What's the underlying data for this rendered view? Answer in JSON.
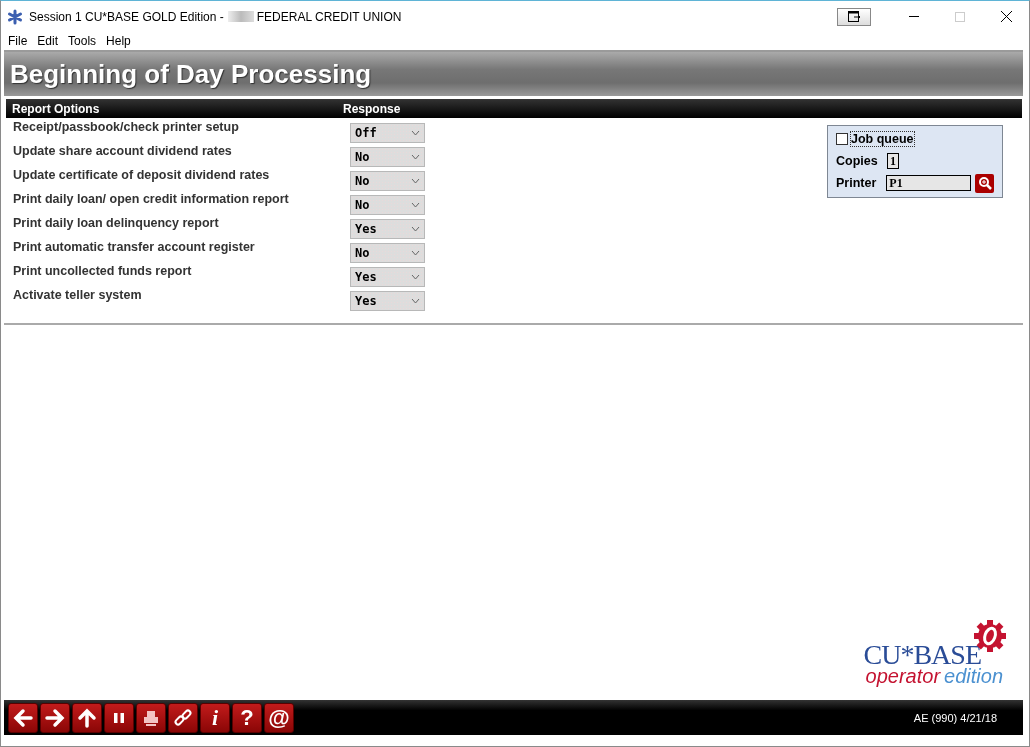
{
  "window": {
    "title": "Session 1 CU*BASE GOLD Edition -",
    "title_end": "FEDERAL CREDIT UNION"
  },
  "menu": [
    "File",
    "Edit",
    "Tools",
    "Help"
  ],
  "page_title": "Beginning of Day Processing",
  "table": {
    "columns": [
      "Report Options",
      "Response"
    ],
    "rows": [
      {
        "option": "Receipt/passbook/check printer setup",
        "response": "Off"
      },
      {
        "option": "Update share account dividend rates",
        "response": "No"
      },
      {
        "option": "Update certificate of deposit dividend rates",
        "response": "No"
      },
      {
        "option": "Print daily loan/ open credit information report",
        "response": "No"
      },
      {
        "option": "Print daily loan delinquency report",
        "response": "Yes"
      },
      {
        "option": "Print automatic transfer account register",
        "response": "No"
      },
      {
        "option": "Print uncollected funds report",
        "response": "Yes"
      },
      {
        "option": "Activate teller system",
        "response": "Yes"
      }
    ]
  },
  "print_panel": {
    "job_queue": {
      "label": "Job queue",
      "checked": false
    },
    "copies": {
      "label": "Copies",
      "value": "1"
    },
    "printer": {
      "label": "Printer",
      "value": "P1"
    }
  },
  "logo": {
    "name": "CU*BASE",
    "word_1": "operator",
    "word_2": "edition"
  },
  "toolbar": [
    {
      "kind": "back"
    },
    {
      "kind": "forward"
    },
    {
      "kind": "up"
    },
    {
      "kind": "pause"
    },
    {
      "kind": "print"
    },
    {
      "kind": "link"
    },
    {
      "kind": "text",
      "label": "i"
    },
    {
      "kind": "text",
      "label": "?"
    },
    {
      "kind": "text",
      "label": "@"
    }
  ],
  "status": "AE (990) 4/21/18"
}
